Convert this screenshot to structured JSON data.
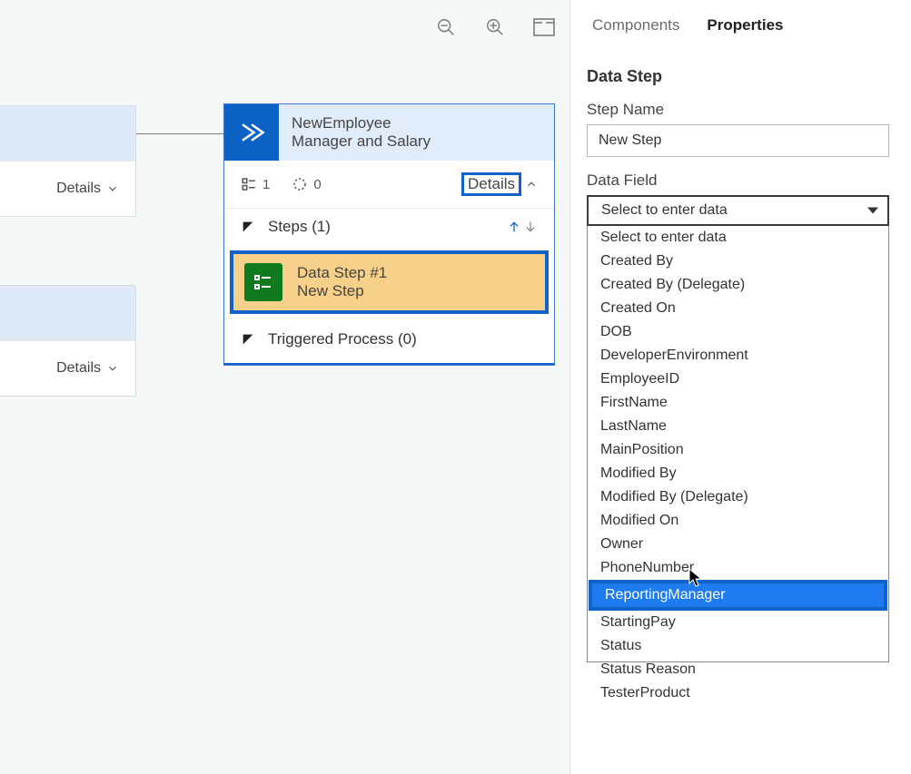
{
  "canvas": {
    "tools": {
      "zoom_out": "zoom-out",
      "zoom_in": "zoom-in",
      "fit": "fit-screen"
    },
    "partial_cards": [
      {
        "details": "Details"
      },
      {
        "details": "Details"
      }
    ],
    "stage": {
      "title_line1": "NewEmployee",
      "title_line2": "Manager and Salary",
      "count_forms": "1",
      "count_flow": "0",
      "details": "Details",
      "steps_header": "Steps (1)",
      "step": {
        "line1": "Data Step #1",
        "line2": "New Step"
      },
      "triggered": "Triggered Process (0)"
    }
  },
  "panel": {
    "tabs": {
      "components": "Components",
      "properties": "Properties"
    },
    "heading": "Data Step",
    "step_name_label": "Step Name",
    "step_name_value": "New Step",
    "data_field_label": "Data Field",
    "data_field_placeholder": "Select to enter data",
    "options": [
      "Select to enter data",
      "Created By",
      "Created By (Delegate)",
      "Created On",
      "DOB",
      "DeveloperEnvironment",
      "EmployeeID",
      "FirstName",
      "LastName",
      "MainPosition",
      "Modified By",
      "Modified By (Delegate)",
      "Modified On",
      "Owner",
      "PhoneNumber",
      "ReportingManager",
      "StartingPay",
      "Status",
      "Status Reason",
      "TesterProduct"
    ],
    "selected_index": 15
  }
}
